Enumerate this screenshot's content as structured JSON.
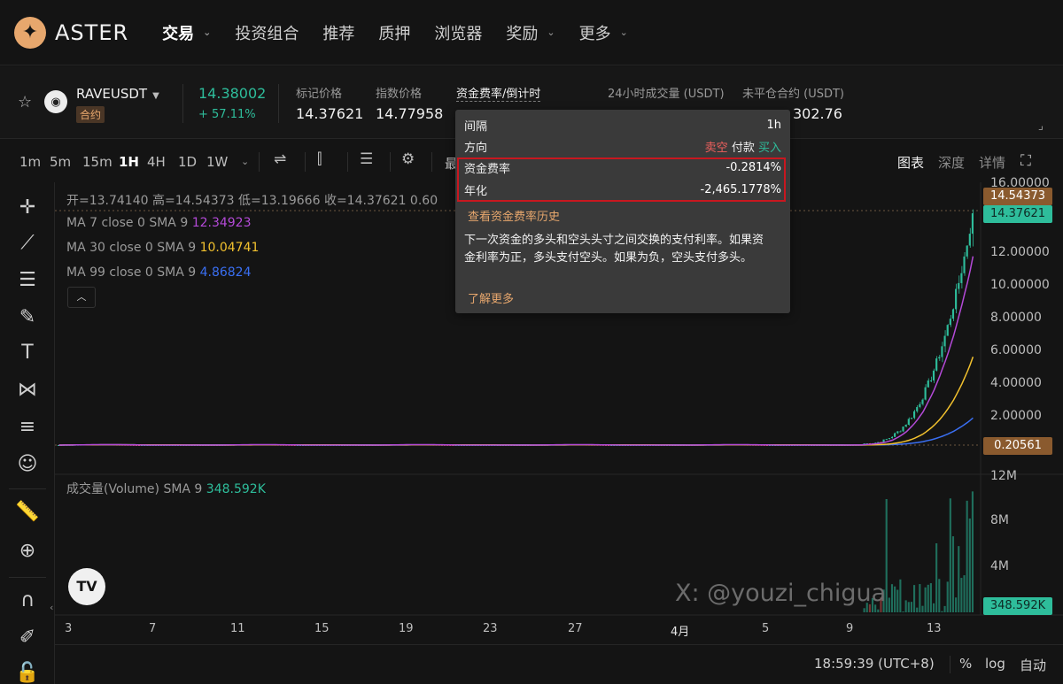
{
  "brand": {
    "name": "ASTER"
  },
  "nav": {
    "items": [
      {
        "label": "交易",
        "has_caret": true
      },
      {
        "label": "投资组合",
        "has_caret": false
      },
      {
        "label": "推荐",
        "has_caret": false
      },
      {
        "label": "质押",
        "has_caret": false
      },
      {
        "label": "浏览器",
        "has_caret": false
      },
      {
        "label": "奖励",
        "has_caret": true
      },
      {
        "label": "更多",
        "has_caret": true
      }
    ]
  },
  "ticker": {
    "symbol": "RAVEUSDT",
    "contract_tag": "合约",
    "last_price": "14.38002",
    "change_pct": "+ 57.11%",
    "mark_price_label": "标记价格",
    "mark_price": "14.37621",
    "index_price_label": "指数价格",
    "index_price": "14.77958",
    "funding_label": "资金费率/倒计时",
    "volume_label": "24小时成交量 (USDT)",
    "open_interest_label": "未平仓合约 (USDT)",
    "open_interest": "302.76"
  },
  "toolbar": {
    "timeframes": [
      "1m",
      "5m",
      "15m",
      "1H",
      "4H",
      "1D",
      "1W"
    ],
    "active_timeframe": "1H",
    "partial_label": "最",
    "views": [
      "图表",
      "深度",
      "详情"
    ],
    "active_view": "图表"
  },
  "legend": {
    "ohlc": "开=13.74140 高=14.54373 低=13.19666 收=14.37621 0.60",
    "ma7_label": "MA 7 close 0 SMA 9",
    "ma7_value": "12.34923",
    "ma30_label": "MA 30 close 0 SMA 9",
    "ma30_value": "10.04741",
    "ma99_label": "MA 99 close 0 SMA 9",
    "ma99_value": "4.86824",
    "volume_label": "成交量(Volume) SMA 9",
    "volume_value": "348.592K"
  },
  "price_axis": {
    "ticks": [
      "16.00000",
      "14.00000",
      "12.00000",
      "10.00000",
      "8.00000",
      "6.00000",
      "4.00000",
      "2.00000"
    ],
    "high_tag": "14.54373",
    "last_tag": "14.37621",
    "low_tag": "0.20561"
  },
  "volume_axis": {
    "ticks": [
      "12M",
      "8M",
      "4M"
    ],
    "current_tag": "348.592K"
  },
  "time_axis": {
    "labels": [
      "3",
      "7",
      "11",
      "15",
      "19",
      "23",
      "27",
      "4月",
      "5",
      "9",
      "13"
    ]
  },
  "watermark": "X: @youzi_chigua",
  "tv_logo": "TV",
  "bottom": {
    "clock": "18:59:39 (UTC+8)",
    "percent": "%",
    "log": "log",
    "auto": "自动"
  },
  "tooltip": {
    "interval_label": "间隔",
    "interval_value": "1h",
    "direction_label": "方向",
    "direction_short": "卖空",
    "direction_pay": "付款",
    "direction_long": "买入",
    "rate_label": "资金费率",
    "rate_value": "-0.2814%",
    "annual_label": "年化",
    "annual_value": "-2,465.1778%",
    "history_link": "查看资金费率历史",
    "description": "下一次资金的多头和空头头寸之间交换的支付利率。如果资金利率为正，多头支付空头。如果为负，空头支付多头。",
    "learn_more": "了解更多"
  },
  "colors": {
    "accent": "#e7a76d",
    "up": "#2ebd9b",
    "down": "#f0605d",
    "ma7": "#b44ad8",
    "ma30": "#f2c12e",
    "ma99": "#3a6ff2",
    "highlight_box": "#c8171f"
  }
}
